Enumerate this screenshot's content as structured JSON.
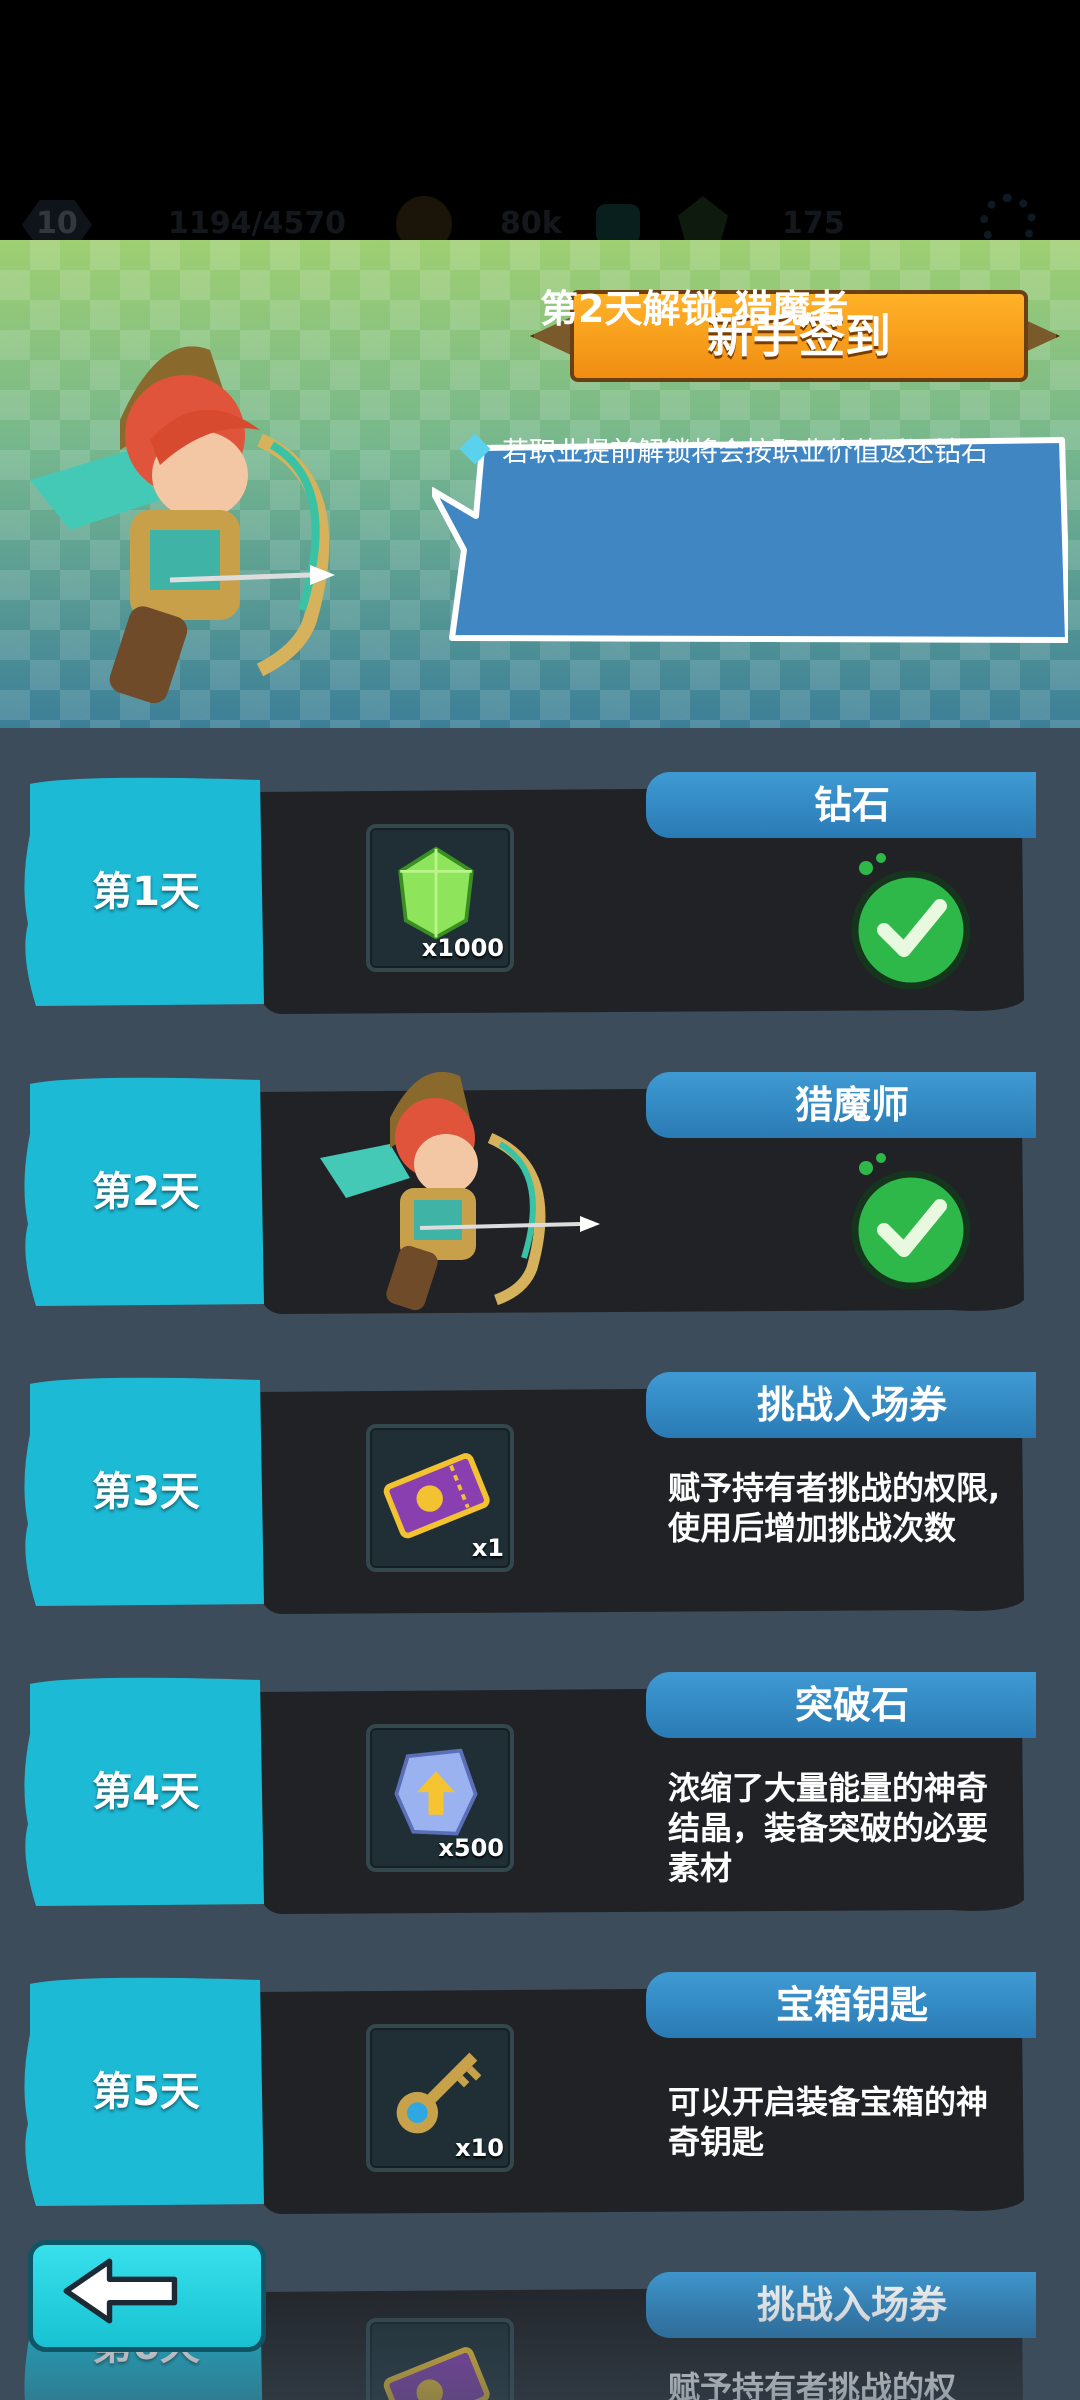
{
  "hud": {
    "level": "10",
    "progress": "1194/4570",
    "coins": "80k",
    "gems": "175"
  },
  "header": {
    "title": "新手签到",
    "unlock_text": "第2天解锁-猎魔者",
    "note": "若职业提前解锁将会按职业价值返还钻石"
  },
  "days": [
    {
      "day": "第1天",
      "reward_name": "钻石",
      "item": "green-gem",
      "qty": "x1000",
      "claimed": true,
      "desc": ""
    },
    {
      "day": "第2天",
      "reward_name": "猎魔师",
      "item": "hero-archer",
      "qty": "",
      "claimed": true,
      "desc": ""
    },
    {
      "day": "第3天",
      "reward_name": "挑战入场券",
      "item": "challenge-ticket",
      "qty": "x1",
      "claimed": false,
      "desc": "赋予持有者挑战的权限,使用后增加挑战次数"
    },
    {
      "day": "第4天",
      "reward_name": "突破石",
      "item": "breakthrough-stone",
      "qty": "x500",
      "claimed": false,
      "desc": "浓缩了大量能量的神奇结晶，装备突破的必要素材"
    },
    {
      "day": "第5天",
      "reward_name": "宝箱钥匙",
      "item": "chest-key",
      "qty": "x10",
      "claimed": false,
      "desc": "可以开启装备宝箱的神奇钥匙"
    },
    {
      "day": "第6天",
      "reward_name": "挑战入场券",
      "item": "challenge-ticket",
      "qty": "",
      "claimed": false,
      "desc": "赋予持有者挑战的权"
    }
  ],
  "icons": {
    "back": "back-arrow-icon",
    "check": "check-mark-icon",
    "settings": "gear-icon",
    "add": "plus-icon"
  },
  "colors": {
    "tab": "#1dbad6",
    "panel": "#202226",
    "title_bar": "#3f9ad3",
    "check_green": "#2fb84a",
    "banner_orange": "#f6a21c"
  }
}
